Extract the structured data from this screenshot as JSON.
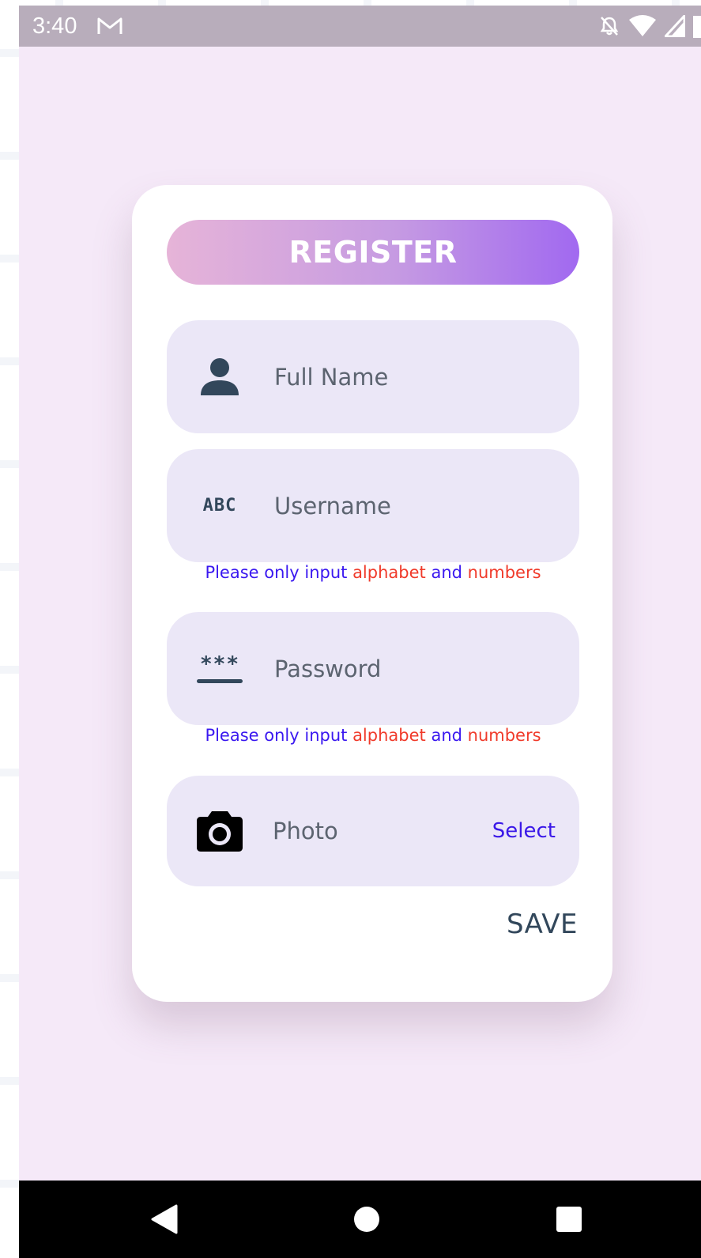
{
  "status_bar": {
    "time": "3:40",
    "icons": [
      "gmail-icon",
      "notifications-off-icon",
      "wifi-icon",
      "cell-signal-icon",
      "battery-icon"
    ]
  },
  "card": {
    "title": "REGISTER",
    "fields": {
      "full_name": {
        "placeholder": "Full Name",
        "icon": "person-icon"
      },
      "username": {
        "placeholder": "Username",
        "icon": "abc-icon",
        "icon_text": "ABC"
      },
      "password": {
        "placeholder": "Password",
        "icon": "password-icon",
        "icon_text": "***"
      },
      "photo": {
        "label": "Photo",
        "icon": "camera-icon",
        "action": "Select"
      }
    },
    "hint": {
      "part1": "Please only input",
      "part2": "alphabet",
      "part3": "and",
      "part4": "numbers"
    },
    "save_label": "SAVE"
  },
  "colors": {
    "background": "#f5e9f8",
    "field_background": "#ebe7f7",
    "banner_gradient_start": "#e6b4d8",
    "banner_gradient_end": "#a169f0",
    "hint_blue": "#3a18f0",
    "hint_red": "#f03a2a",
    "icon_dark": "#32475b"
  },
  "nav_bar": {
    "icons": [
      "back-icon",
      "home-icon",
      "recents-icon"
    ]
  }
}
